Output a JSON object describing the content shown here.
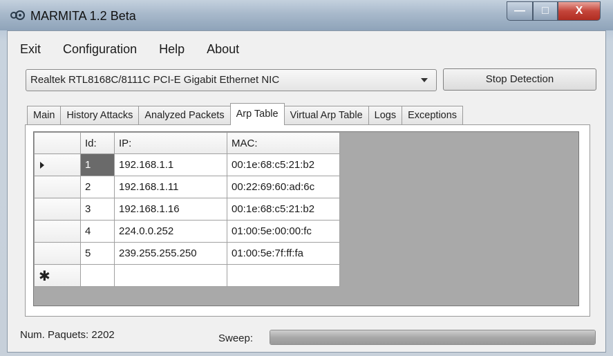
{
  "window": {
    "title": "MARMITA 1.2 Beta",
    "min": "—",
    "max": "□",
    "close": "X"
  },
  "menu": [
    "Exit",
    "Configuration",
    "Help",
    "About"
  ],
  "adapter": {
    "selected": "Realtek RTL8168C/8111C PCI-E Gigabit Ethernet NIC"
  },
  "stop_button": "Stop Detection",
  "tabs": [
    "Main",
    "History Attacks",
    "Analyzed Packets",
    "Arp Table",
    "Virtual Arp Table",
    "Logs",
    "Exceptions"
  ],
  "active_tab": "Arp Table",
  "table": {
    "columns": [
      "Id:",
      "IP:",
      "MAC:"
    ],
    "rows": [
      {
        "id": "1",
        "ip": "192.168.1.1",
        "mac": "00:1e:68:c5:21:b2"
      },
      {
        "id": "2",
        "ip": "192.168.1.11",
        "mac": "00:22:69:60:ad:6c"
      },
      {
        "id": "3",
        "ip": "192.168.1.16",
        "mac": "00:1e:68:c5:21:b2"
      },
      {
        "id": "4",
        "ip": "224.0.0.252",
        "mac": "01:00:5e:00:00:fc"
      },
      {
        "id": "5",
        "ip": "239.255.255.250",
        "mac": "01:00:5e:7f:ff:fa"
      }
    ],
    "new_row_marker": "✱"
  },
  "status": {
    "packets": "Num. Paquets: 2202",
    "sweep_label": "Sweep:",
    "sweep_progress": 1.0
  },
  "colors": {
    "selected_cell": "#6a6a6a",
    "grid_background": "#a9a9a9"
  }
}
